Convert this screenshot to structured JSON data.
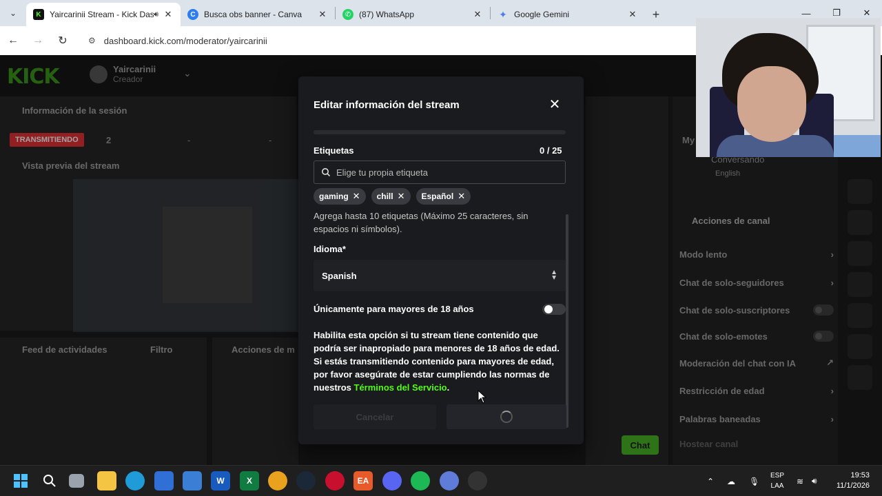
{
  "browser": {
    "tabs": [
      {
        "label": "Yaircarinii Stream - Kick Das",
        "icon": "kick-favicon",
        "active": true
      },
      {
        "label": "Busca obs banner - Canva",
        "icon": "canva-favicon",
        "active": false
      },
      {
        "label": "(87) WhatsApp",
        "icon": "whatsapp-favicon",
        "active": false
      },
      {
        "label": "Google Gemini",
        "icon": "gemini-favicon",
        "active": false
      }
    ],
    "url": "dashboard.kick.com/moderator/yaircarinii"
  },
  "kick": {
    "user_name": "Yaircarinii",
    "user_role": "Creador",
    "session_title": "Información de la sesión",
    "live_badge": "TRANSMITIENDO",
    "viewer_count": "2",
    "dash1": "-",
    "dash2": "-",
    "preview_title": "Vista previa del stream",
    "feed_title": "Feed de actividades",
    "feed_filter": "Filtro",
    "mod_actions_title": "Acciones de m",
    "chat_button": "Chat",
    "right": {
      "partial_title": "My",
      "conversation": "Conversando",
      "language": "English",
      "channel_actions_title": "Acciones de canal",
      "items": [
        {
          "label": "Modo lento",
          "control": "chevron"
        },
        {
          "label": "Chat de solo-seguidores",
          "control": "chevron"
        },
        {
          "label": "Chat de solo-suscriptores",
          "control": "toggle"
        },
        {
          "label": "Chat de solo-emotes",
          "control": "toggle"
        },
        {
          "label": "Moderación del chat con IA",
          "control": "external"
        },
        {
          "label": "Restricción de edad",
          "control": "chevron"
        },
        {
          "label": "Palabras baneadas",
          "control": "chevron"
        },
        {
          "label": "Hostear canal",
          "control": "none"
        }
      ]
    }
  },
  "modal": {
    "title": "Editar información del stream",
    "tags_label": "Etiquetas",
    "tags_counter": "0 / 25",
    "tag_placeholder": "Elige tu propia etiqueta",
    "tags": [
      "gaming",
      "chill",
      "Español"
    ],
    "tags_help": "Agrega hasta 10 etiquetas (Máximo 25 caracteres, sin espacios ni símbolos).",
    "language_label": "Idioma*",
    "language_value": "Spanish",
    "adult_label": "Únicamente para mayores de 18 años",
    "adult_enabled": false,
    "adult_desc": "Habilita esta opción si tu stream tiene contenido que podría ser inapropiado para menores de 18 años de edad. Si estás transmitiendo contenido para mayores de edad, por favor asegúrate de estar cumpliendo las normas de nuestros ",
    "terms_link": "Términos del Servicio",
    "terms_suffix": ".",
    "cancel_label": "Cancelar"
  },
  "taskbar": {
    "lang_top": "ESP",
    "lang_bottom": "LAA",
    "time": "19:53",
    "date": "11/1/2026"
  },
  "colors": {
    "kick_green": "#53fc18",
    "live_red": "#e4242a",
    "modal_bg": "#1a1b1e"
  }
}
